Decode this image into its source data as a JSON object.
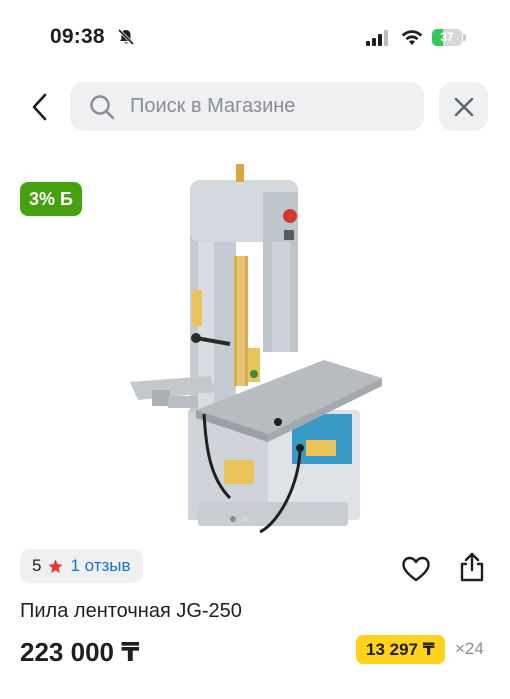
{
  "status_bar": {
    "time": "09:38",
    "battery_level": "37",
    "battery_fraction": 0.37
  },
  "search": {
    "placeholder": "Поиск в Магазине",
    "value": ""
  },
  "product": {
    "cashback_badge": "3% Б",
    "rating": "5",
    "reviews": "1 отзыв",
    "title": "Пила ленточная JG-250",
    "price": "223 000 ₸",
    "installment_price": "13 297 ₸",
    "installment_months": "×24",
    "carousel_active_index": 0,
    "carousel_total": 2
  },
  "icons": {
    "back": "chevron-left-icon",
    "search": "search-icon",
    "close": "close-icon",
    "favorite": "heart-icon",
    "share": "share-icon",
    "star": "star-icon",
    "mute": "bell-slash-icon"
  },
  "colors": {
    "badge_green": "#45a10f",
    "installment_yellow": "#ffd21c",
    "link_blue": "#1a6ed8",
    "star_red": "#e53935",
    "pill_gray": "#eff0f2"
  }
}
